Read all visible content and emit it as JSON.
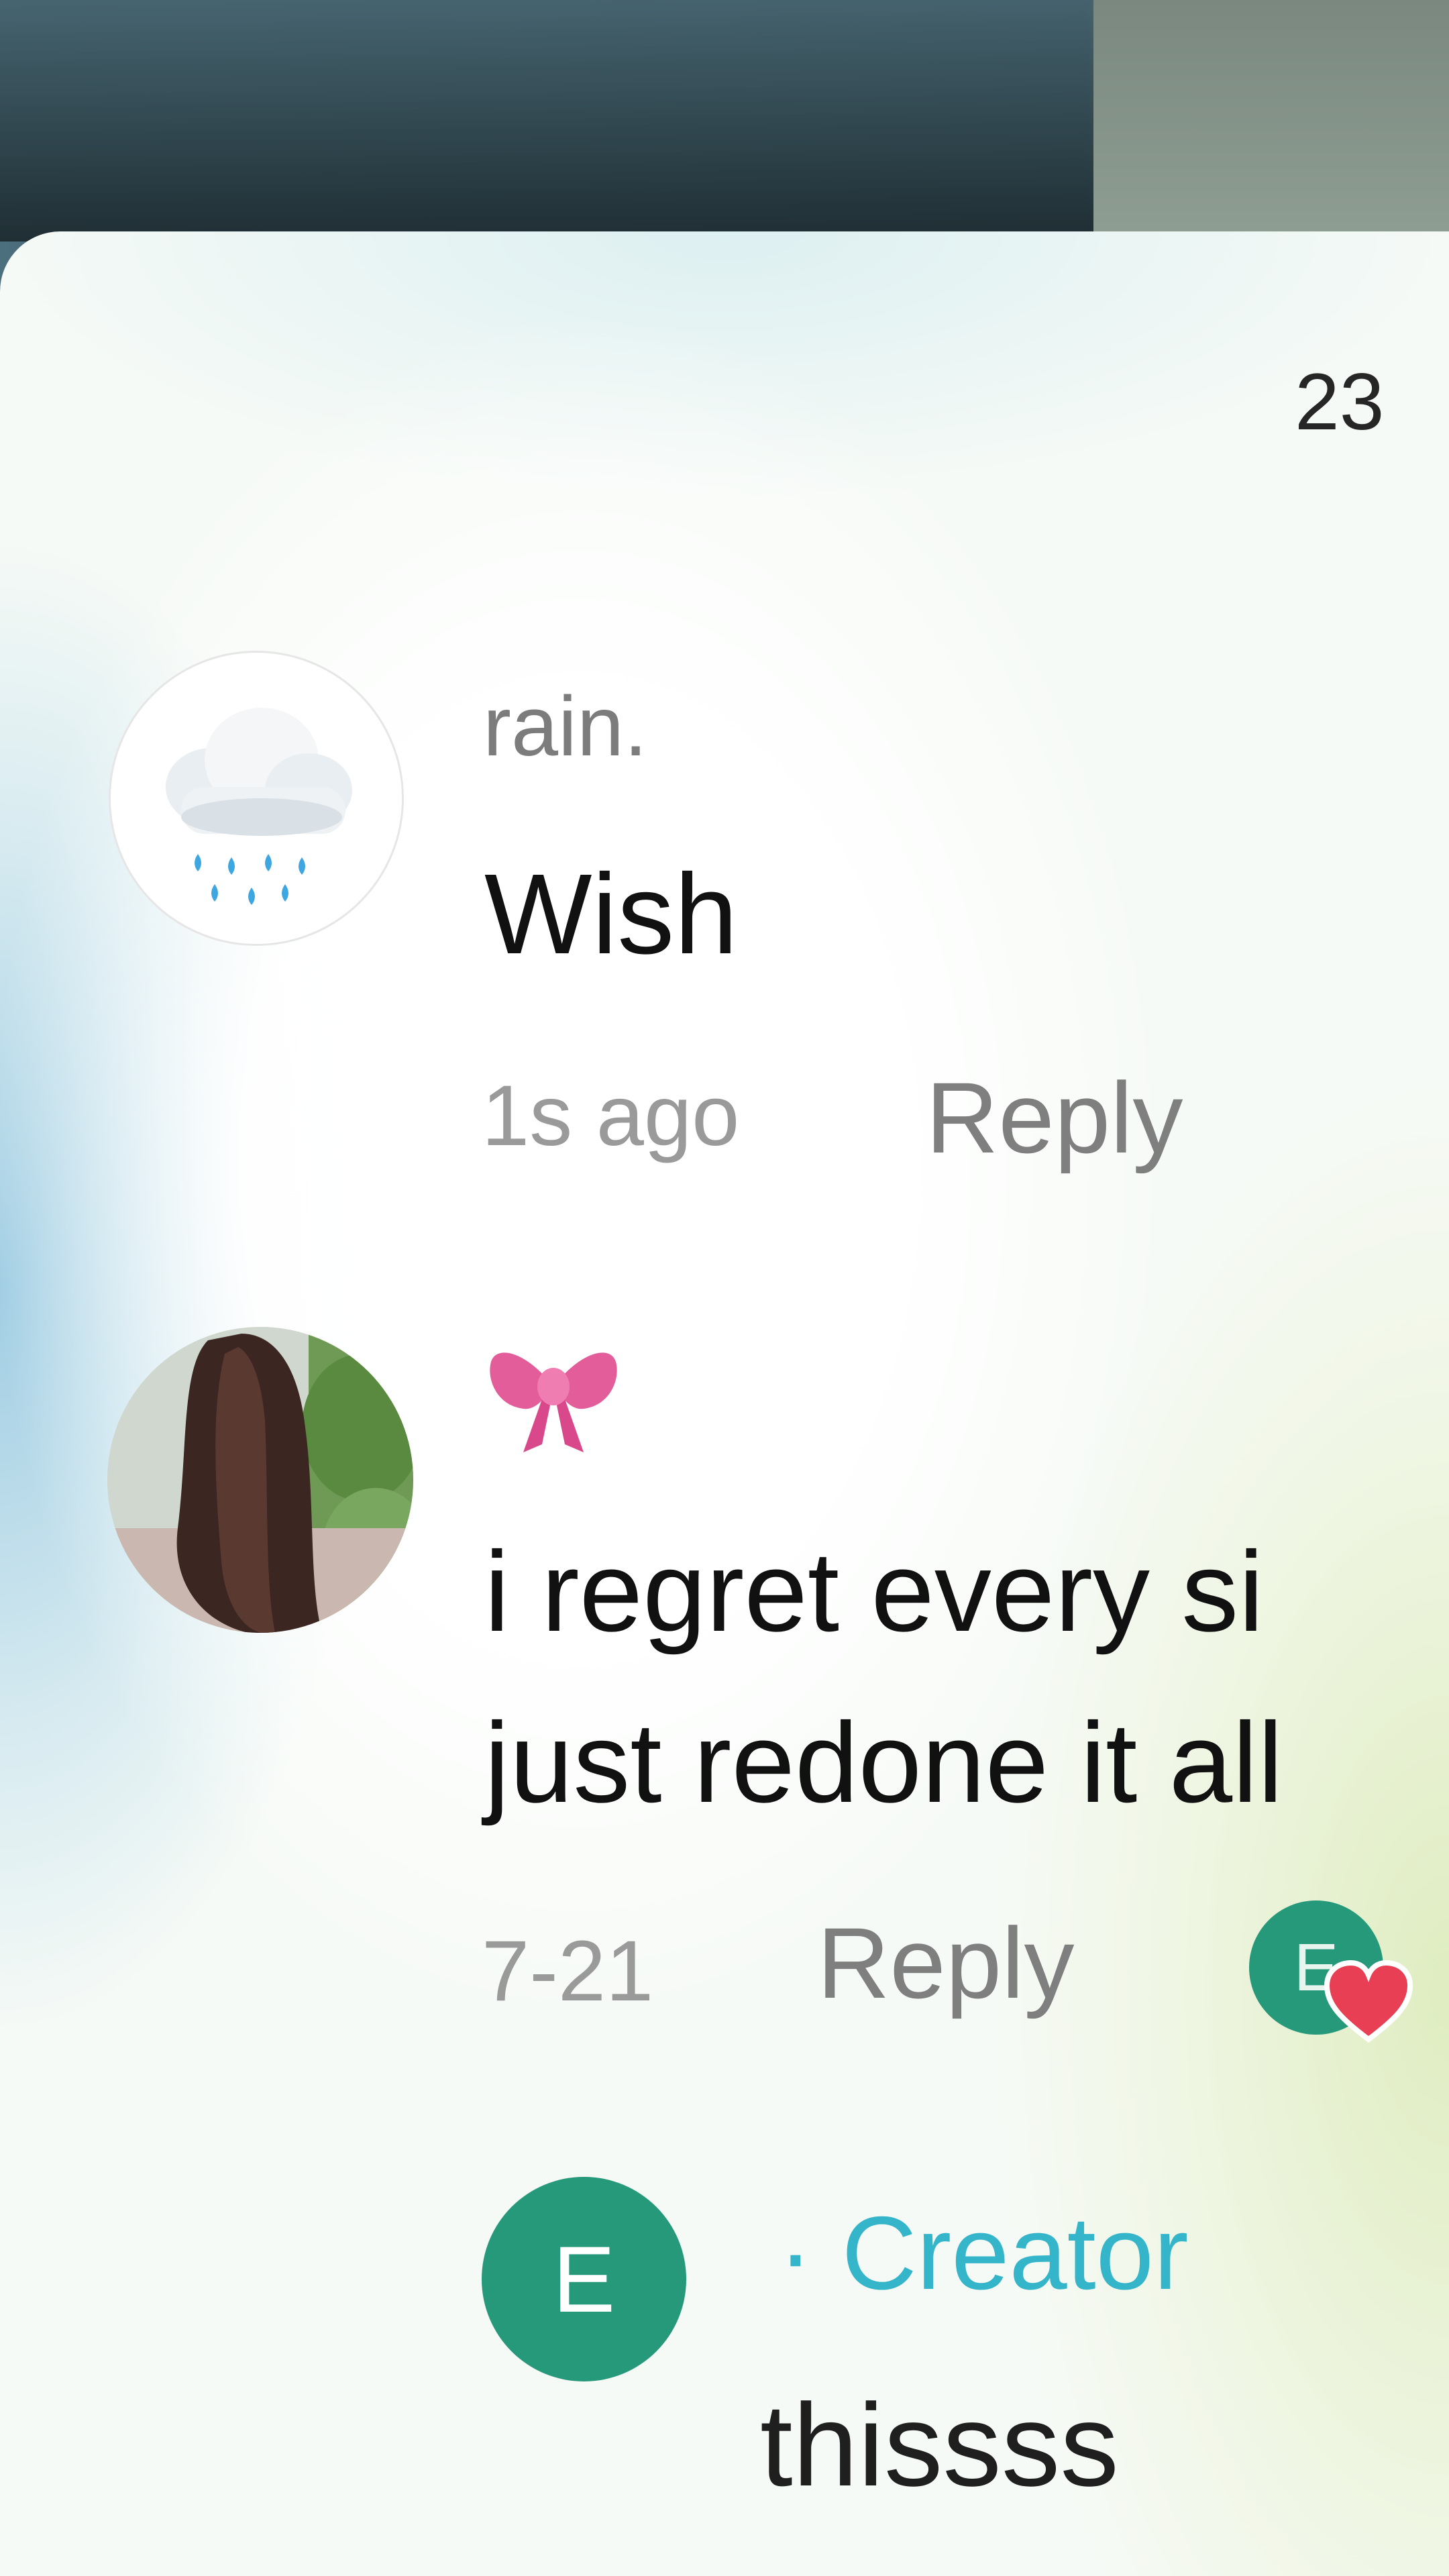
{
  "header": {
    "comment_count": "23"
  },
  "comments": [
    {
      "username": "rain.",
      "text": "Wish",
      "time": "1s ago",
      "reply_label": "Reply",
      "avatar_icon": "rain-cloud-icon"
    },
    {
      "username_icon": "pink-bow-icon",
      "text_line1": "i regret every si",
      "text_line2": "just redone it all",
      "time": "7-21",
      "reply_label": "Reply",
      "liked_by_initial": "E",
      "liked_badge_icon": "heart-icon",
      "reply": {
        "avatar_initial": "E",
        "creator_label": "· Creator",
        "text": "thissss"
      }
    }
  ],
  "colors": {
    "creator_green": "#27997b",
    "creator_label": "#35b5c9",
    "heart": "#e83f55",
    "bow": "#e25d9a"
  }
}
